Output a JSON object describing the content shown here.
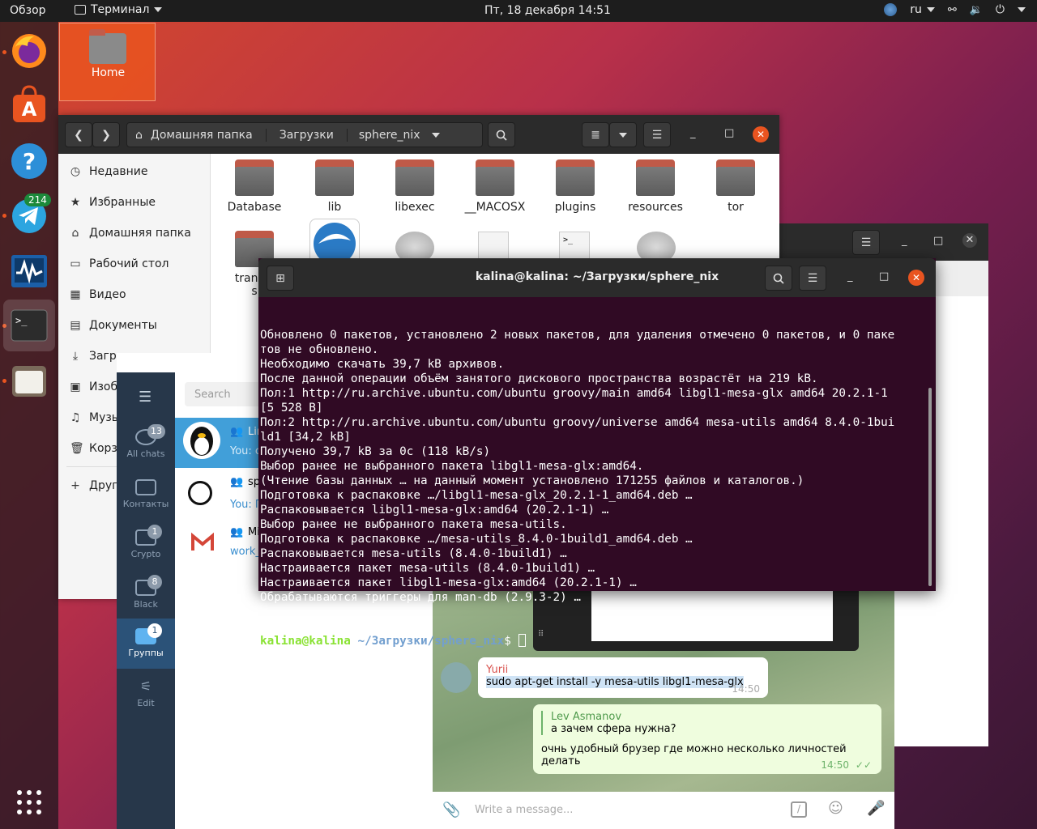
{
  "topbar": {
    "overview": "Обзор",
    "app_name": "Терминал",
    "clock": "Пт, 18 декабря  14:51",
    "lang": "ru"
  },
  "dock": {
    "telegram_badge": "214",
    "items": [
      "firefox-icon",
      "software-center-icon",
      "help-icon",
      "telegram-icon",
      "system-monitor-icon",
      "terminal-icon",
      "files-icon",
      "app-grid-icon"
    ]
  },
  "desktop": {
    "home_label": "Home"
  },
  "file_manager": {
    "breadcrumb": [
      "Домашняя папка",
      "Загрузки",
      "sphere_nix"
    ],
    "sidebar": [
      {
        "icon": "clock-icon",
        "label": "Недавние"
      },
      {
        "icon": "star-icon",
        "label": "Избранные"
      },
      {
        "icon": "home-icon",
        "label": "Домашняя папка"
      },
      {
        "icon": "desktop-icon",
        "label": "Рабочий стол"
      },
      {
        "icon": "video-icon",
        "label": "Видео"
      },
      {
        "icon": "document-icon",
        "label": "Документы"
      },
      {
        "icon": "download-icon",
        "label": "Загрузки"
      },
      {
        "icon": "image-icon",
        "label": "Изоб"
      },
      {
        "icon": "music-icon",
        "label": "Музы"
      },
      {
        "icon": "trash-icon",
        "label": "Корз"
      },
      {
        "icon": "plus-icon",
        "label": "Други"
      }
    ],
    "folders": [
      "Database",
      "lib",
      "libexec",
      "__MACOSX",
      "plugins",
      "resources",
      "tor"
    ],
    "row2_first_label": "transla",
    "row2_first_label2": "s"
  },
  "terminal": {
    "title": "kalina@kalina: ~/Загрузки/sphere_nix",
    "lines": [
      "Обновлено 0 пакетов, установлено 2 новых пакетов, для удаления отмечено 0 пакетов, и 0 паке",
      "тов не обновлено.",
      "Необходимо скачать 39,7 kB архивов.",
      "После данной операции объём занятого дискового пространства возрастёт на 219 kB.",
      "Пол:1 http://ru.archive.ubuntu.com/ubuntu groovy/main amd64 libgl1-mesa-glx amd64 20.2.1-1",
      "[5 528 B]",
      "Пол:2 http://ru.archive.ubuntu.com/ubuntu groovy/universe amd64 mesa-utils amd64 8.4.0-1bui",
      "ld1 [34,2 kB]",
      "Получено 39,7 kB за 0с (118 kB/s)",
      "Выбор ранее не выбранного пакета libgl1-mesa-glx:amd64.",
      "(Чтение базы данных … на данный момент установлено 171255 файлов и каталогов.)",
      "Подготовка к распаковке …/libgl1-mesa-glx_20.2.1-1_amd64.deb …",
      "Распаковывается libgl1-mesa-glx:amd64 (20.2.1-1) …",
      "Выбор ранее не выбранного пакета mesa-utils.",
      "Подготовка к распаковке …/mesa-utils_8.4.0-1build1_amd64.deb …",
      "Распаковывается mesa-utils (8.4.0-1build1) …",
      "Настраивается пакет mesa-utils (8.4.0-1build1) …",
      "Настраивается пакет libgl1-mesa-glx:amd64 (20.2.1-1) …",
      "Обрабатываются триггеры для man-db (2.9.3-2) …"
    ],
    "prompt_user": "kalina@kalina",
    "prompt_sep": ":",
    "prompt_path": "~/Загрузки/sphere_nix",
    "prompt_end": "$ "
  },
  "telegram": {
    "search_placeholder": "Search",
    "rail": [
      {
        "label": "All chats",
        "badge": "13"
      },
      {
        "label": "Контакты",
        "badge": ""
      },
      {
        "label": "Crypto",
        "badge": "1"
      },
      {
        "label": "Black",
        "badge": "8"
      },
      {
        "label": "Группы",
        "badge": "1"
      },
      {
        "label": "Edit",
        "badge": ""
      }
    ],
    "chats": [
      {
        "title": "Lin",
        "preview": "You: c"
      },
      {
        "title": "sp",
        "preview": "You: П"
      },
      {
        "title": "Mi",
        "preview": "work_"
      }
    ],
    "messages": [
      {
        "author": "Yurii",
        "text": "sudo apt-get install -y mesa-utils libgl1-mesa-glx",
        "time": "14:50"
      },
      {
        "quote_author": "Lev Asmanov",
        "quote_text": "а зачем сфера нужна?",
        "text": "очнь удобный брузер где можно несколько личностей делать",
        "time": "14:50"
      }
    ],
    "compose_placeholder": "Write a message..."
  }
}
